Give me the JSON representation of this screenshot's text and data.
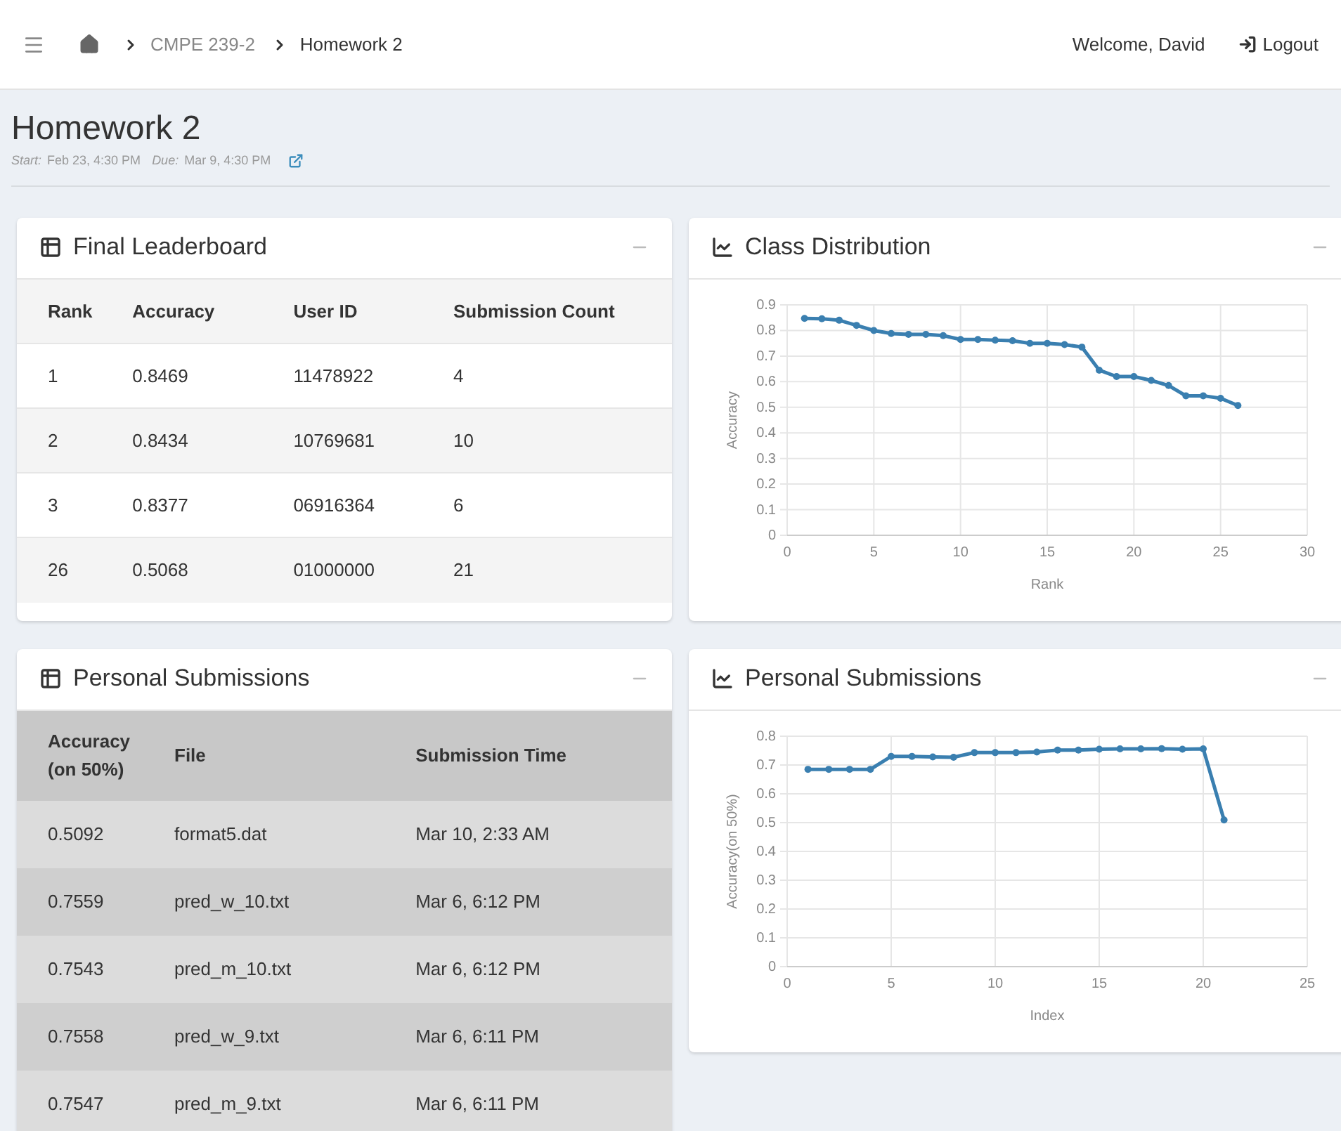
{
  "navbar": {
    "breadcrumb": [
      {
        "label": "CMPE 239-2",
        "current": false
      },
      {
        "label": "Homework 2",
        "current": true
      }
    ],
    "welcome": "Welcome, David",
    "logout": "Logout"
  },
  "page": {
    "title": "Homework 2",
    "start_label": "Start:",
    "start": "Feb 23, 4:30 PM",
    "due_label": "Due:",
    "due": "Mar 9, 4:30 PM"
  },
  "leaderboard": {
    "title": "Final Leaderboard",
    "columns": [
      "Rank",
      "Accuracy",
      "User ID",
      "Submission Count"
    ],
    "rows": [
      [
        "1",
        "0.8469",
        "11478922",
        "4"
      ],
      [
        "2",
        "0.8434",
        "10769681",
        "10"
      ],
      [
        "3",
        "0.8377",
        "06916364",
        "6"
      ],
      [
        "26",
        "0.5068",
        "01000000",
        "21"
      ]
    ]
  },
  "class_distribution": {
    "title": "Class Distribution",
    "chart_data": {
      "type": "line",
      "xlabel": "Rank",
      "ylabel": "Accuracy",
      "x": [
        1,
        2,
        3,
        4,
        5,
        6,
        7,
        8,
        9,
        10,
        11,
        12,
        13,
        14,
        15,
        16,
        17,
        18,
        19,
        20,
        21,
        22,
        23,
        24,
        25,
        26
      ],
      "series": [
        {
          "color": "#3a7fb0",
          "marker": true,
          "values": [
            0.847,
            0.846,
            0.84,
            0.82,
            0.8,
            0.788,
            0.785,
            0.785,
            0.78,
            0.765,
            0.765,
            0.762,
            0.76,
            0.75,
            0.75,
            0.745,
            0.735,
            0.645,
            0.62,
            0.62,
            0.605,
            0.585,
            0.545,
            0.545,
            0.535,
            0.507
          ]
        }
      ],
      "grid": true,
      "xlim": [
        0,
        30
      ],
      "ylim": [
        0,
        0.9
      ],
      "xticks": [
        0,
        5,
        10,
        15,
        20,
        25,
        30
      ],
      "yticks": [
        0,
        0.1,
        0.2,
        0.3,
        0.4,
        0.5,
        0.6,
        0.7,
        0.8,
        0.9
      ]
    }
  },
  "personal_submissions": {
    "title": "Personal Submissions",
    "columns": [
      "Accuracy (on 50%)",
      "File",
      "Submission Time"
    ],
    "rows": [
      [
        "0.5092",
        "format5.dat",
        "Mar 10, 2:33 AM"
      ],
      [
        "0.7559",
        "pred_w_10.txt",
        "Mar 6, 6:12 PM"
      ],
      [
        "0.7543",
        "pred_m_10.txt",
        "Mar 6, 6:12 PM"
      ],
      [
        "0.7558",
        "pred_w_9.txt",
        "Mar 6, 6:11 PM"
      ],
      [
        "0.7547",
        "pred_m_9.txt",
        "Mar 6, 6:11 PM"
      ]
    ]
  },
  "personal_chart": {
    "title": "Personal Submissions",
    "chart_data": {
      "type": "line",
      "xlabel": "Index",
      "ylabel": "Accuracy(on 50%)",
      "x": [
        1,
        2,
        3,
        4,
        5,
        6,
        7,
        8,
        9,
        10,
        11,
        12,
        13,
        14,
        15,
        16,
        17,
        18,
        19,
        20,
        21
      ],
      "series": [
        {
          "color": "#3a7fb0",
          "marker": true,
          "values": [
            0.685,
            0.685,
            0.685,
            0.685,
            0.73,
            0.73,
            0.728,
            0.727,
            0.743,
            0.743,
            0.743,
            0.745,
            0.752,
            0.752,
            0.755,
            0.756,
            0.756,
            0.757,
            0.755,
            0.756,
            0.509
          ]
        }
      ],
      "grid": true,
      "xlim": [
        0,
        25
      ],
      "ylim": [
        0,
        0.8
      ],
      "xticks": [
        0,
        5,
        10,
        15,
        20,
        25
      ],
      "yticks": [
        0,
        0.1,
        0.2,
        0.3,
        0.4,
        0.5,
        0.6,
        0.7,
        0.8
      ]
    }
  }
}
